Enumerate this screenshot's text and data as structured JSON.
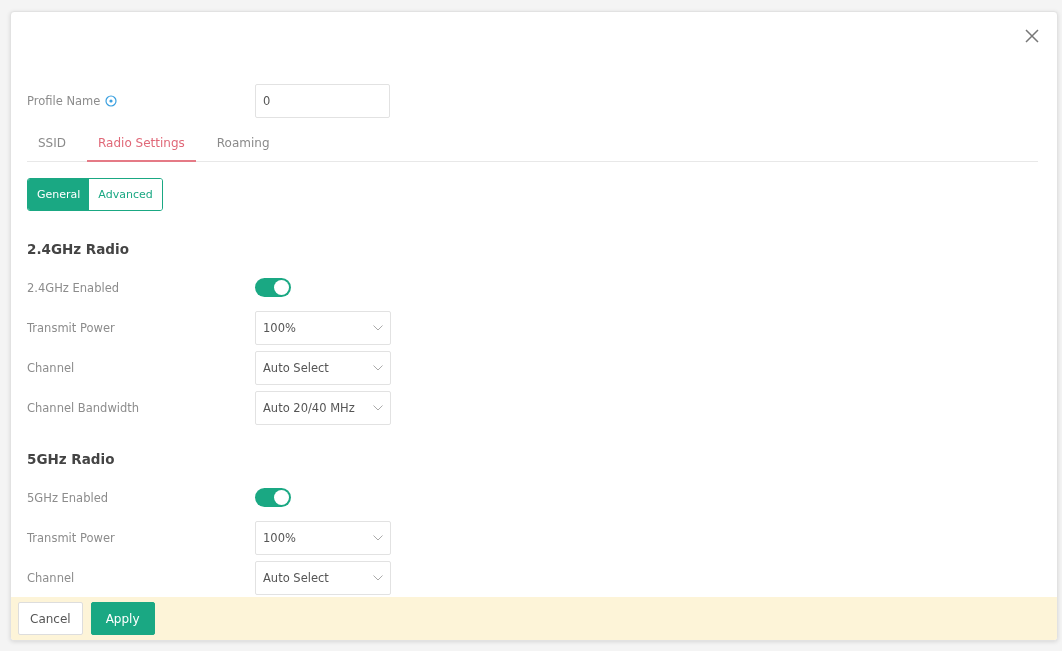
{
  "profile_name": {
    "label": "Profile Name",
    "value": "0"
  },
  "tabs": [
    {
      "label": "SSID",
      "selected": false
    },
    {
      "label": "Radio Settings",
      "selected": true
    },
    {
      "label": "Roaming",
      "selected": false
    }
  ],
  "subtabs": [
    {
      "label": "General",
      "selected": true
    },
    {
      "label": "Advanced",
      "selected": false
    }
  ],
  "sections": [
    {
      "title": "2.4GHz Radio",
      "rows": [
        {
          "kind": "toggle",
          "label": "2.4GHz Enabled",
          "on": true
        },
        {
          "kind": "select",
          "label": "Transmit Power",
          "value": "100%"
        },
        {
          "kind": "select",
          "label": "Channel",
          "value": "Auto Select"
        },
        {
          "kind": "select",
          "label": "Channel Bandwidth",
          "value": "Auto 20/40 MHz"
        }
      ]
    },
    {
      "title": "5GHz Radio",
      "rows": [
        {
          "kind": "toggle",
          "label": "5GHz Enabled",
          "on": true
        },
        {
          "kind": "select",
          "label": "Transmit Power",
          "value": "100%"
        },
        {
          "kind": "select",
          "label": "Channel",
          "value": "Auto Select"
        }
      ]
    }
  ],
  "footer": {
    "buttons": [
      {
        "label": "Cancel",
        "kind": "secondary"
      },
      {
        "label": "Apply",
        "kind": "primary"
      }
    ]
  }
}
